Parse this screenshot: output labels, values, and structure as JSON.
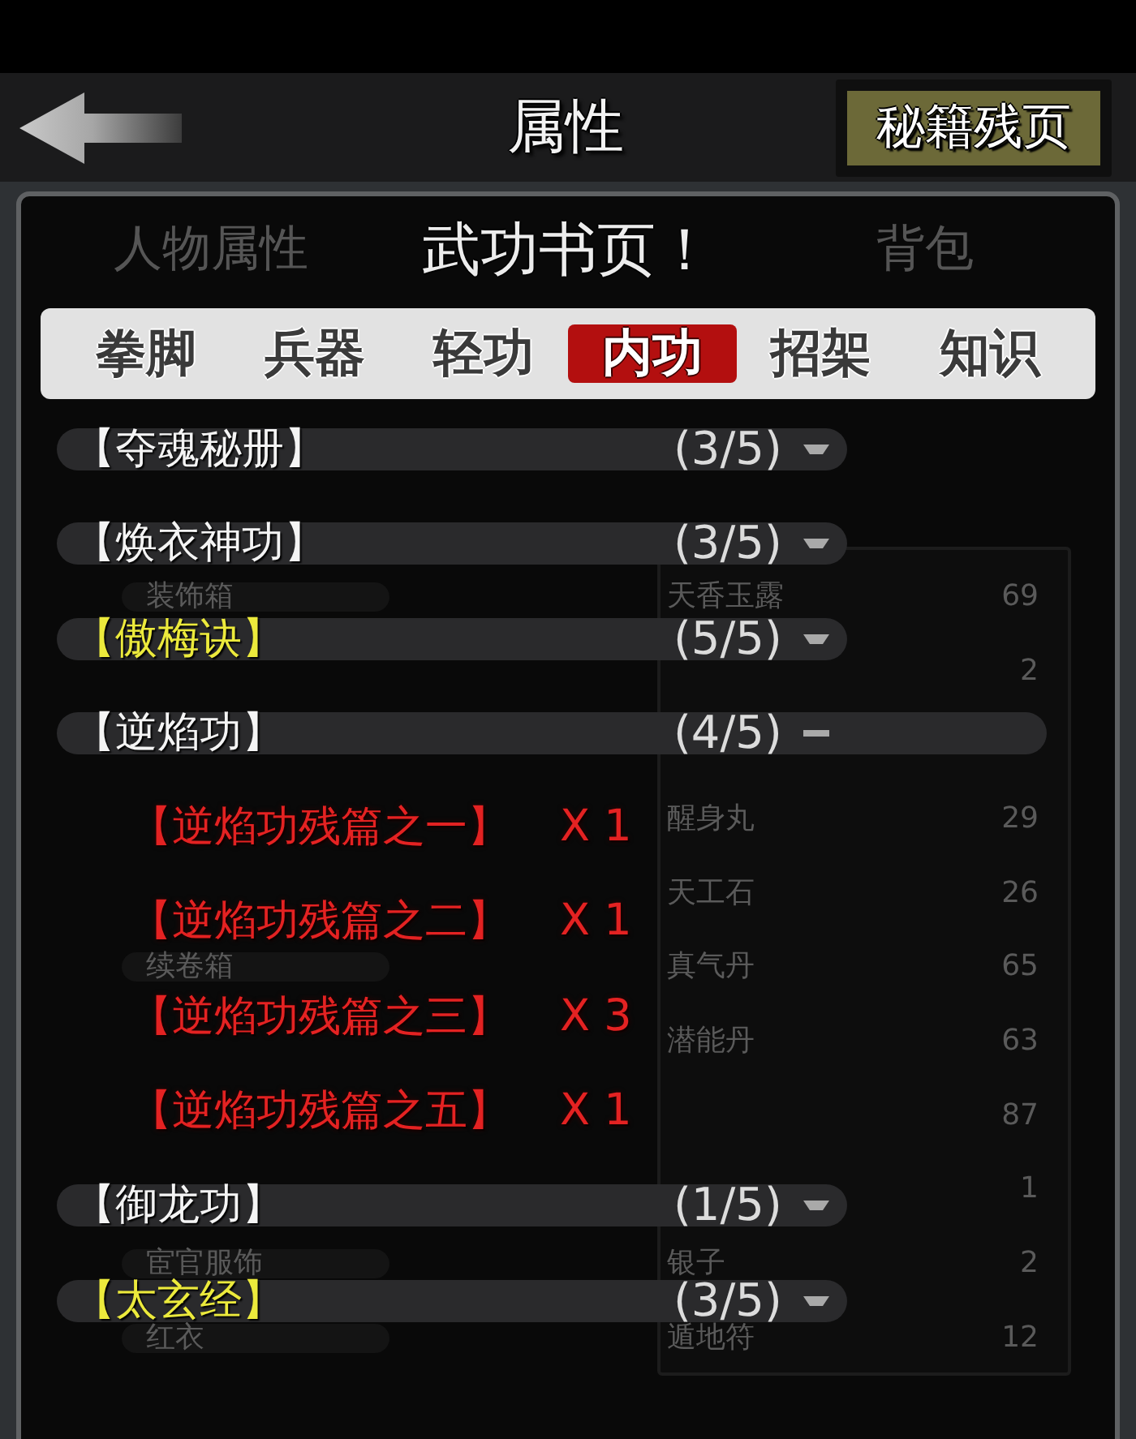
{
  "header": {
    "title": "属性",
    "button": "秘籍残页"
  },
  "background": {
    "tabs": [
      "人物属性",
      "背包"
    ],
    "inventory": {
      "groups": [
        [
          {
            "left_label": "装饰箱",
            "item": "天香玉露",
            "count": "69"
          },
          {
            "count": "2"
          }
        ],
        [
          {
            "item": "醒身丸",
            "count": "29"
          },
          {
            "item": "天工石",
            "count": "26"
          },
          {
            "left_label": "续卷箱",
            "item": "真气丹",
            "count": "65"
          },
          {
            "item": "潜能丹",
            "count": "63"
          },
          {
            "count": "87"
          },
          {
            "count": "1"
          },
          {
            "left_label": "宦官服饰",
            "item": "银子",
            "count": "2"
          },
          {
            "left_label": "红衣",
            "item": "遁地符",
            "count": "12"
          }
        ]
      ]
    }
  },
  "dialog": {
    "title": "武功书页！",
    "tabs": [
      {
        "label": "拳脚",
        "selected": false
      },
      {
        "label": "兵器",
        "selected": false
      },
      {
        "label": "轻功",
        "selected": false
      },
      {
        "label": "内功",
        "selected": true
      },
      {
        "label": "招架",
        "selected": false
      },
      {
        "label": "知识",
        "selected": false
      }
    ],
    "items": [
      {
        "name": "【夺魂秘册】",
        "progress": "(3/5)",
        "highlighted": false,
        "expanded": false
      },
      {
        "name": "【焕衣神功】",
        "progress": "(3/5)",
        "highlighted": false,
        "expanded": false
      },
      {
        "name": "【傲梅诀】",
        "progress": "(5/5)",
        "highlighted": true,
        "expanded": false
      },
      {
        "name": "【逆焰功】",
        "progress": "(4/5)",
        "highlighted": false,
        "expanded": true,
        "children": [
          {
            "name": "【逆焰功残篇之一】",
            "count": "X 1"
          },
          {
            "name": "【逆焰功残篇之二】",
            "count": "X 1"
          },
          {
            "name": "【逆焰功残篇之三】",
            "count": "X 3"
          },
          {
            "name": "【逆焰功残篇之五】",
            "count": "X 1"
          }
        ]
      },
      {
        "name": "【御龙功】",
        "progress": "(1/5)",
        "highlighted": false,
        "expanded": false
      },
      {
        "name": "【太玄经】",
        "progress": "(3/5)",
        "highlighted": true,
        "expanded": false
      }
    ]
  }
}
